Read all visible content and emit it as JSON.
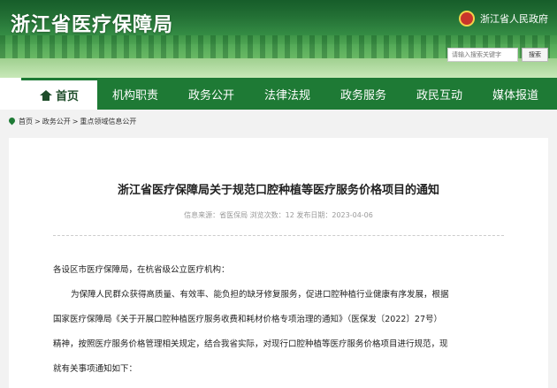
{
  "header": {
    "site_title": "浙江省医疗保障局",
    "gov_link": "浙江省人民政府",
    "search_placeholder": "请输入搜索关键字",
    "search_button": "搜索"
  },
  "nav": {
    "items": [
      {
        "label": "首页"
      },
      {
        "label": "机构职责"
      },
      {
        "label": "政务公开"
      },
      {
        "label": "法律法规"
      },
      {
        "label": "政务服务"
      },
      {
        "label": "政民互动"
      },
      {
        "label": "媒体报道"
      }
    ]
  },
  "breadcrumb": {
    "items": [
      "首页",
      "政务公开",
      "重点领域信息公开"
    ],
    "separator": ">"
  },
  "article": {
    "title": "浙江省医疗保障局关于规范口腔种植等医疗服务价格项目的通知",
    "meta": "信息来源：省医保局 浏览次数：12 发布日期：2023-04-06",
    "salutation": "各设区市医疗保障局，在杭省级公立医疗机构：",
    "paragraph_lines": [
      "为保障人民群众获得高质量、有效率、能负担的缺牙修复服务，促进口腔种植行业健康有序发展，根据",
      "国家医疗保障局《关于开展口腔种植医疗服务收费和耗材价格专项治理的通知》（医保发〔2022〕27号）",
      "精神，按照医疗服务价格管理相关规定，结合我省实际，对现行口腔种植等医疗服务价格项目进行规范，现",
      "就有关事项通知如下："
    ]
  },
  "colors": {
    "nav_green": "#1e7a35",
    "header_green": "#3d9a4e"
  }
}
